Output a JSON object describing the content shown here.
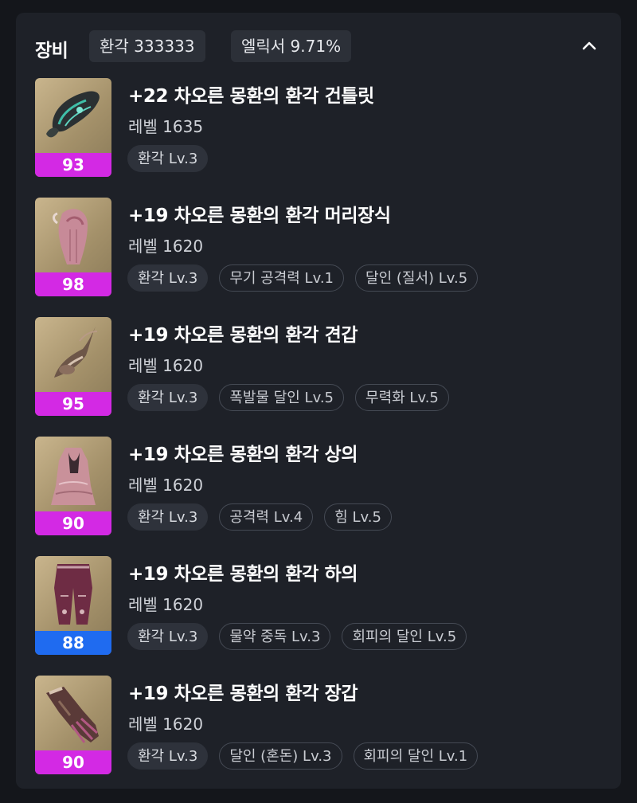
{
  "header": {
    "title": "장비",
    "chip_1": "환각 333333",
    "chip_2": "엘릭서 9.71%",
    "collapse_icon": "chevron-up-icon"
  },
  "colors": {
    "quality_purple": "#d329e4",
    "quality_blue": "#1f6bf0"
  },
  "items": [
    {
      "name": "+22 차오른 몽환의 환각 건틀릿",
      "level": "레벨 1635",
      "quality": "93",
      "quality_color": "#d329e4",
      "icon": "gauntlet-icon",
      "tags": [
        "환각 Lv.3"
      ]
    },
    {
      "name": "+19 차오른 몽환의 환각 머리장식",
      "level": "레벨 1620",
      "quality": "98",
      "quality_color": "#d329e4",
      "icon": "headgear-icon",
      "tags": [
        "환각 Lv.3",
        "무기 공격력 Lv.1",
        "달인 (질서) Lv.5"
      ]
    },
    {
      "name": "+19 차오른 몽환의 환각 견갑",
      "level": "레벨 1620",
      "quality": "95",
      "quality_color": "#d329e4",
      "icon": "shoulder-icon",
      "tags": [
        "환각 Lv.3",
        "폭발물 달인 Lv.5",
        "무력화 Lv.5"
      ]
    },
    {
      "name": "+19 차오른 몽환의 환각 상의",
      "level": "레벨 1620",
      "quality": "90",
      "quality_color": "#d329e4",
      "icon": "chest-armor-icon",
      "tags": [
        "환각 Lv.3",
        "공격력 Lv.4",
        "힘 Lv.5"
      ]
    },
    {
      "name": "+19 차오른 몽환의 환각 하의",
      "level": "레벨 1620",
      "quality": "88",
      "quality_color": "#1f6bf0",
      "icon": "pants-icon",
      "tags": [
        "환각 Lv.3",
        "물약 중독 Lv.3",
        "회피의 달인 Lv.5"
      ]
    },
    {
      "name": "+19 차오른 몽환의 환각 장갑",
      "level": "레벨 1620",
      "quality": "90",
      "quality_color": "#d329e4",
      "icon": "gloves-icon",
      "tags": [
        "환각 Lv.3",
        "달인 (혼돈) Lv.3",
        "회피의 달인 Lv.1"
      ]
    }
  ]
}
